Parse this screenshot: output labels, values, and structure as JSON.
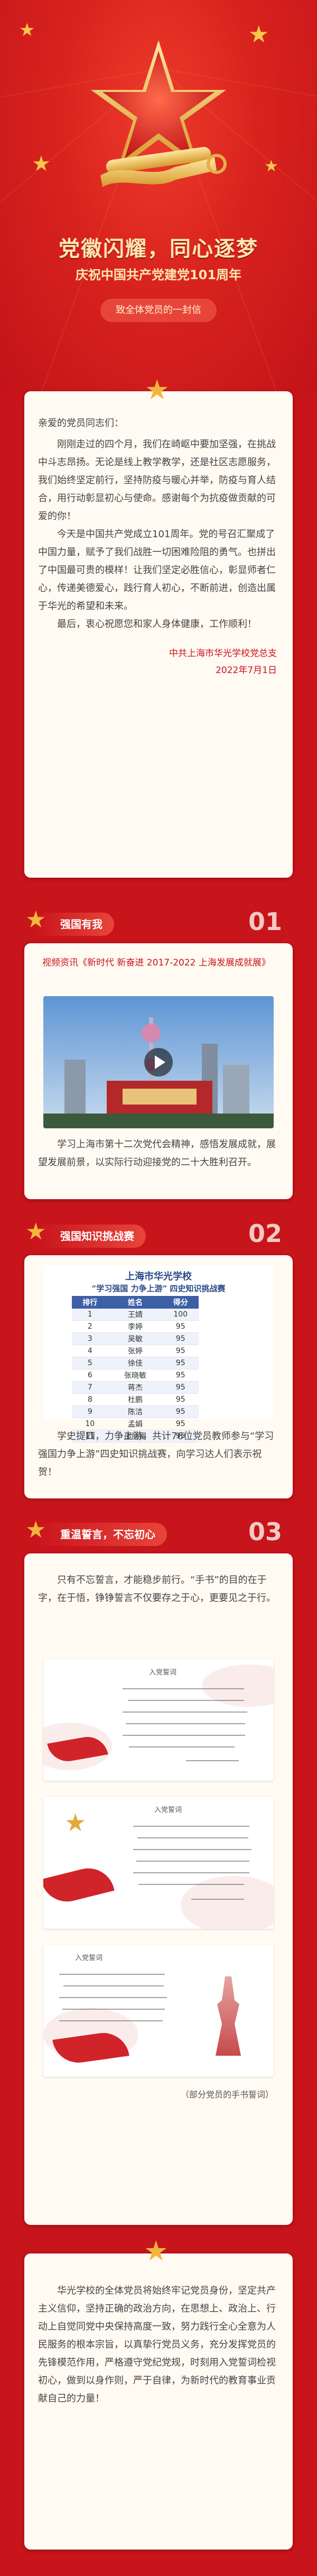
{
  "hero": {
    "title": "党徽闪耀，同心逐梦",
    "subtitle": "庆祝中国共产党建党101周年",
    "pill": "致全体党员的一封信"
  },
  "letter": {
    "greeting": "亲爱的党员同志们：",
    "paragraphs": [
      "刚刚走过的四个月，我们在崎岖中要加坚强，在挑战中斗志昂扬。无论是线上教学教学，还是社区志愿服务，我们始终坚定前行，坚持防疫与暖心并举，防疫与育人结合，用行动彰显初心与使命。感谢每个为抗疫做贡献的可爱的你！",
      "今天是中国共产党成立101周年。党的号召汇聚成了中国力量，赋予了我们战胜一切困难险阻的勇气。也拼出了中国最可贵的模样！让我们坚定必胜信心，彰显师者仁心，传递美德爱心，践行育人初心，不断前进，创造出属于华光的希望和未来。",
      "最后，衷心祝愿您和家人身体健康，工作顺利！"
    ],
    "signature": "中共上海市华光学校党总支",
    "date": "2022年7月1日"
  },
  "sections": [
    {
      "number": "01",
      "title": "强国有我",
      "video_label": "视频资讯《新时代 新奋进 2017-2022 上海发展成就展》",
      "paragraph": "学习上海市第十二次党代会精神，感悟发展成就，展望发展前景，以实际行动迎接党的二十大胜利召开。"
    },
    {
      "number": "02",
      "title": "强国知识挑战赛",
      "table_title": "上海市华光学校",
      "table_subtitle": "“学习强国 力争上游” 四史知识挑战赛",
      "columns": [
        "排行",
        "姓名",
        "得分"
      ],
      "rows": [
        [
          "1",
          "王婧",
          "100"
        ],
        [
          "2",
          "李婷",
          "95"
        ],
        [
          "3",
          "吴敏",
          "95"
        ],
        [
          "4",
          "张婷",
          "95"
        ],
        [
          "5",
          "徐佳",
          "95"
        ],
        [
          "6",
          "张晓敏",
          "95"
        ],
        [
          "7",
          "蒋杰",
          "95"
        ],
        [
          "8",
          "杜鹏",
          "95"
        ],
        [
          "9",
          "陈洁",
          "95"
        ],
        [
          "10",
          "孟娟",
          "95"
        ],
        [
          "11",
          "邵丽娟",
          "95"
        ]
      ],
      "paragraph": "学史提四，力争上游。共计76位党员教师参与“学习强国力争上游”四史知识挑战赛，向学习达人们表示祝贺！"
    },
    {
      "number": "03",
      "title": "重温誓言，不忘初心",
      "paragraph": "只有不忘誓言，才能稳步前行。“手书”的目的在于字，在于悟，铮铮誓言不仅要存之于心，更要见之于行。",
      "caption": "（部分党员的手书誓词）",
      "scroll_titles": [
        "入党誓词",
        "入党誓词",
        "入党誓词"
      ]
    }
  ],
  "closing": {
    "paragraph": "华光学校的全体党员将始终牢记党员身份，坚定共产主义信仰，坚持正确的政治方向，在思想上、政治上、行动上自觉同党中央保持高度一致，努力践行全心全意为人民服务的根本宗旨，以真挚行党员义务，充分发挥党员的先锋模范作用，严格遵守党纪党规，时刻用入党誓词检视初心，做到以身作则，严于自律，为新时代的教育事业贡献自己的力量！"
  }
}
